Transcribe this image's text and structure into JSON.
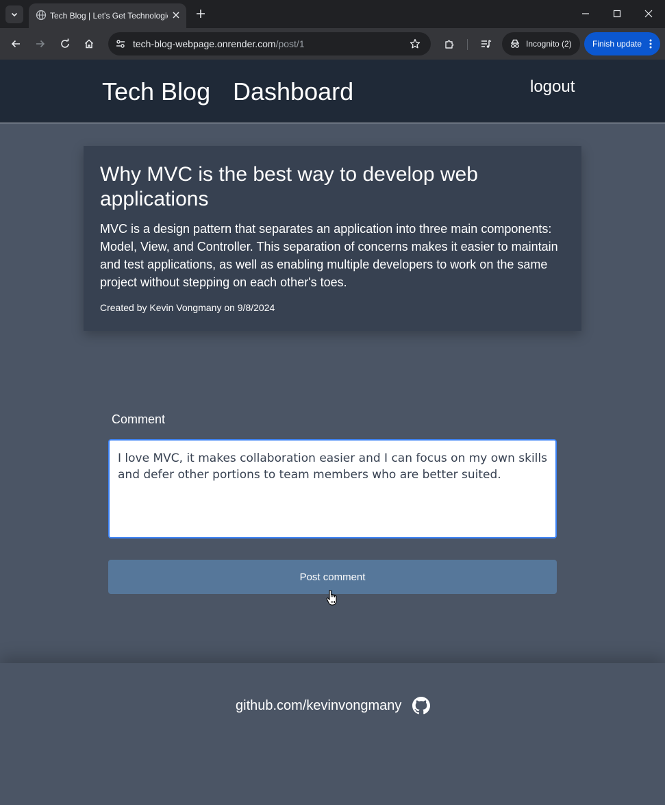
{
  "browser": {
    "tab_title": "Tech Blog | Let's Get Technological",
    "url_host": "tech-blog-webpage.onrender.com",
    "url_path": "/post/1",
    "incognito_label": "Incognito (2)",
    "finish_update_label": "Finish update",
    "accent_color": "#0b57d0"
  },
  "header": {
    "brand": "Tech Blog",
    "dashboard_link": "Dashboard",
    "logout_link": "logout"
  },
  "post": {
    "title": "Why MVC is the best way to develop web applications",
    "body": "MVC is a design pattern that separates an application into three main components: Model, View, and Controller. This separation of concerns makes it easier to maintain and test applications, as well as enabling multiple developers to work on the same project without stepping on each other's toes.",
    "meta": "Created by Kevin Vongmany on 9/8/2024"
  },
  "comment_form": {
    "label": "Comment",
    "value": "I love MVC, it makes collaboration easier and I can focus on my own skills and defer other portions to team members who are better suited.",
    "submit_label": "Post comment"
  },
  "footer": {
    "github_text": "github.com/kevinvongmany"
  },
  "colors": {
    "page_bg": "#4b5565",
    "header_bg": "#1f2937",
    "card_bg": "#374151",
    "button_bg": "#56779a"
  }
}
